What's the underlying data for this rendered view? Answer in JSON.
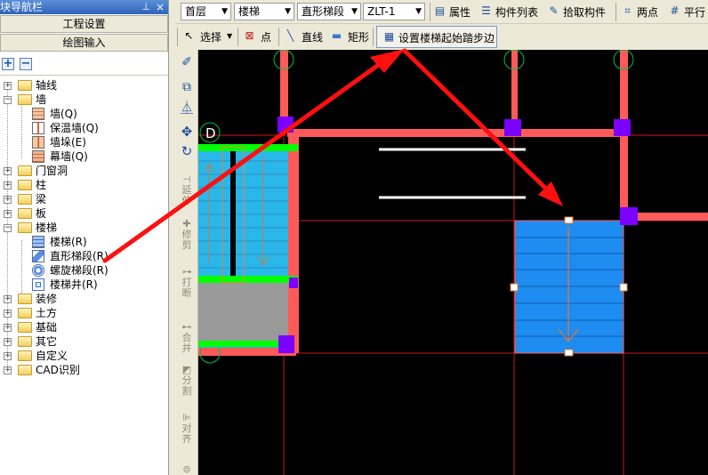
{
  "nav": {
    "title": "模块导航栏",
    "pin_icon": "pin-icon",
    "close_label": "×",
    "btn_project": "工程设置",
    "btn_drawing": "绘图输入",
    "tree": [
      {
        "label": "轴线",
        "expander": "+"
      },
      {
        "label": "墙",
        "expander": "-"
      },
      {
        "label": "墙(Q)"
      },
      {
        "label": "保温墙(Q)"
      },
      {
        "label": "墙垛(E)"
      },
      {
        "label": "幕墙(Q)"
      },
      {
        "label": "门窗洞",
        "expander": "+"
      },
      {
        "label": "柱",
        "expander": "+"
      },
      {
        "label": "梁",
        "expander": "+"
      },
      {
        "label": "板",
        "expander": "+"
      },
      {
        "label": "楼梯",
        "expander": "-"
      },
      {
        "label": "楼梯(R)"
      },
      {
        "label": "直形梯段(R)"
      },
      {
        "label": "螺旋梯段(R)"
      },
      {
        "label": "楼梯井(R)"
      },
      {
        "label": "装修",
        "expander": "+"
      },
      {
        "label": "土方",
        "expander": "+"
      },
      {
        "label": "基础",
        "expander": "+"
      },
      {
        "label": "其它",
        "expander": "+"
      },
      {
        "label": "自定义",
        "expander": "+"
      },
      {
        "label": "CAD识别",
        "expander": "+"
      }
    ]
  },
  "toolbar1": {
    "floor": "首层",
    "category": "楼梯",
    "component_type": "直形梯段",
    "component": "ZLT-1",
    "properties": "属性",
    "component_list": "构件列表",
    "pick_component": "拾取构件",
    "two_points": "两点",
    "parallel": "平行"
  },
  "toolbar2": {
    "select": "选择",
    "point": "点",
    "line": "直线",
    "rect": "矩形",
    "set_start_step": "设置楼梯起始踏步边"
  },
  "vtoolbar": {
    "extend": "延伸",
    "trim": "修剪",
    "break": "打断",
    "merge": "合并",
    "split": "分割",
    "align": "对齐"
  },
  "canvas": {
    "axis_d": "D",
    "axis_c": "C",
    "colors": {
      "background": "#000000",
      "wall": "#ff5a5a",
      "stair_blue": "#1e8cf0",
      "stair_cyan": "#2ab7ea",
      "column": "#7a00ff",
      "landing": "#00ff00",
      "annotation_arrow": "#ff1010"
    }
  }
}
